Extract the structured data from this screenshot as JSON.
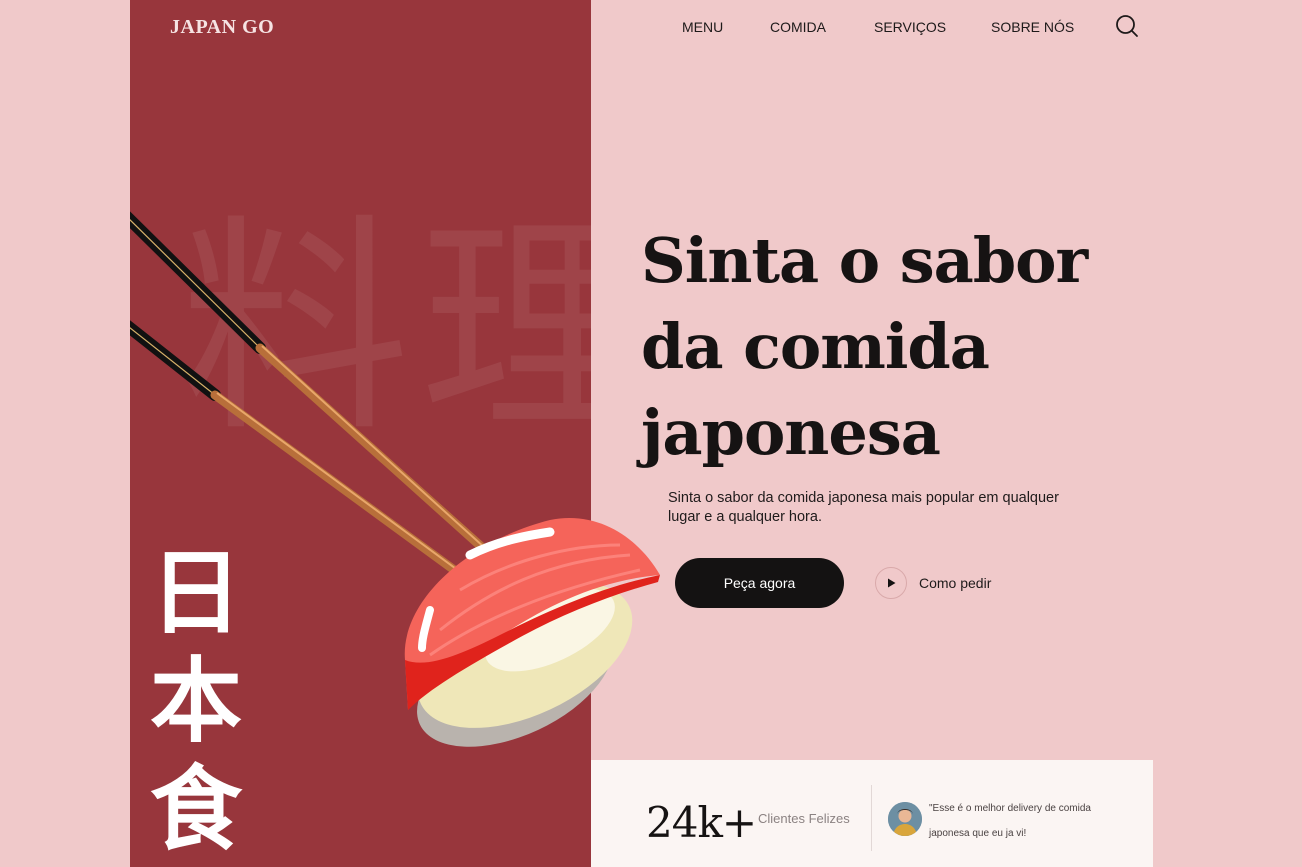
{
  "brand": {
    "logo": "JAPAN GO"
  },
  "nav": {
    "items": [
      "MENU",
      "COMIDA",
      "SERVIÇOS",
      "SOBRE NÓS"
    ]
  },
  "decor": {
    "watermark": "料理",
    "vertical_kanji": [
      "日",
      "本",
      "食"
    ]
  },
  "hero": {
    "title_lines": [
      "Sinta o sabor",
      "da comida",
      "japonesa"
    ],
    "subtitle": "Sinta o sabor da comida japonesa mais popular em qualquer lugar e a qualquer hora.",
    "primary_button": "Peça agora",
    "secondary_link": "Como pedir"
  },
  "stats": {
    "number": "24k+",
    "label": "Clientes Felizes",
    "testimonial": "\"Esse é o melhor delivery de comida japonesa que eu ja vi!"
  },
  "colors": {
    "left_panel": "#98363c",
    "background": "#f0c9ca",
    "button": "#141212",
    "card": "#fbf5f3"
  }
}
